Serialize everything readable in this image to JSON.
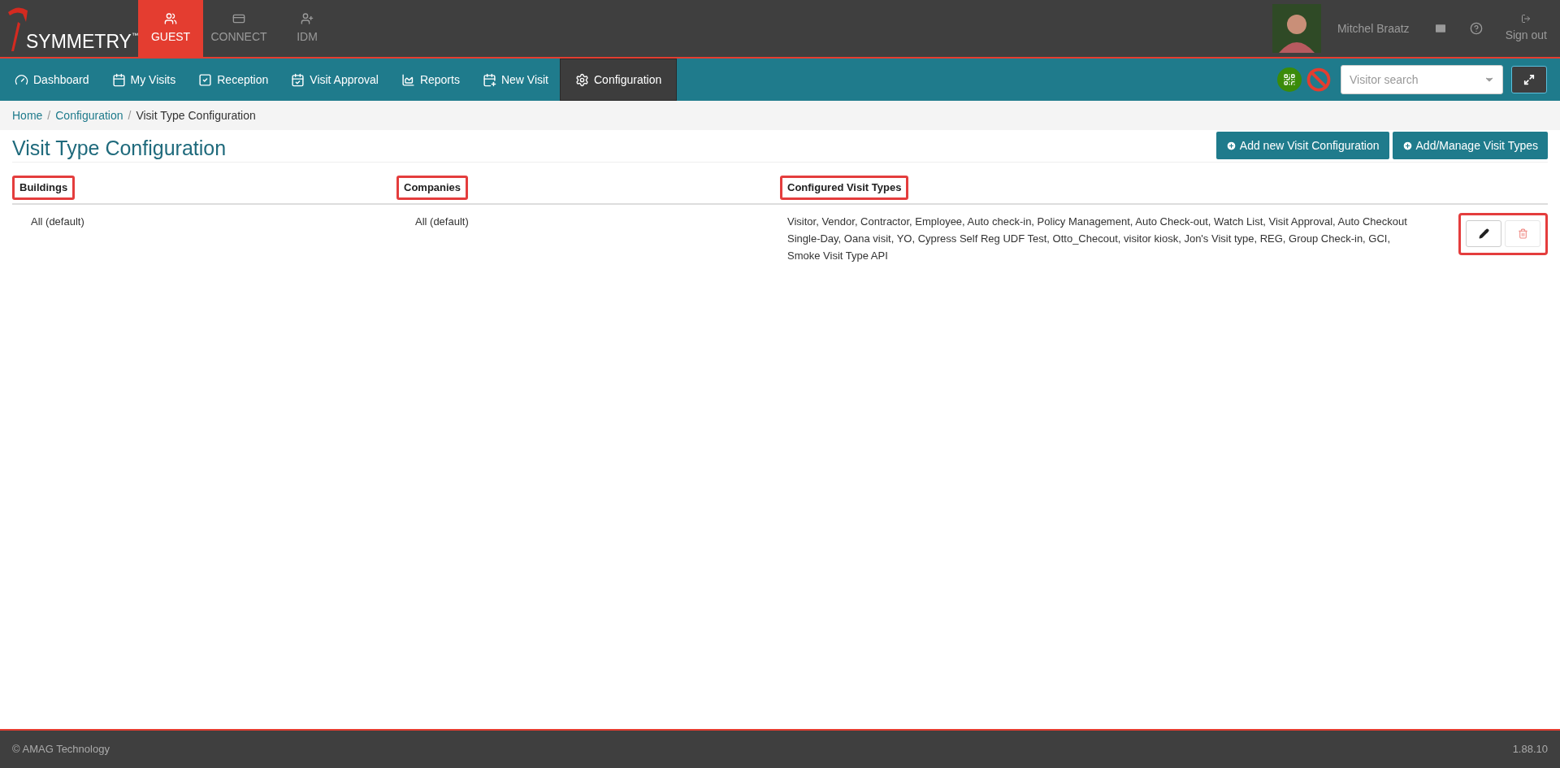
{
  "header": {
    "logo": "SYMMETRY",
    "logo_mark": "™",
    "apps": [
      {
        "label": "GUEST",
        "selected": true
      },
      {
        "label": "CONNECT",
        "selected": false
      },
      {
        "label": "IDM",
        "selected": false
      }
    ],
    "user_name": "Mitchel Braatz",
    "sign_out": "Sign out"
  },
  "nav": {
    "items": [
      {
        "label": "Dashboard",
        "selected": false
      },
      {
        "label": "My Visits",
        "selected": false
      },
      {
        "label": "Reception",
        "selected": false
      },
      {
        "label": "Visit Approval",
        "selected": false
      },
      {
        "label": "Reports",
        "selected": false
      },
      {
        "label": "New Visit",
        "selected": false
      },
      {
        "label": "Configuration",
        "selected": true
      }
    ],
    "search": {
      "placeholder": "Visitor search"
    }
  },
  "breadcrumb": [
    {
      "label": "Home",
      "link": true,
      "separator": "/"
    },
    {
      "label": "Configuration",
      "link": true,
      "separator": "/"
    },
    {
      "label": "Visit Type Configuration",
      "link": false
    }
  ],
  "page": {
    "title": "Visit Type Configuration",
    "buttons": [
      "Add new Visit Configuration",
      "Add/Manage Visit Types"
    ]
  },
  "table": {
    "columns": [
      {
        "label": "Buildings",
        "highlighted": true
      },
      {
        "label": "Companies",
        "highlighted": true
      },
      {
        "label": "Configured Visit Types",
        "highlighted": true
      }
    ],
    "rows": [
      {
        "cells": [
          "All (default)",
          "All (default)",
          "Visitor, Vendor, Contractor, Employee, Auto check-in, Policy Management, Auto Check-out, Watch List, Visit Approval, Auto Checkout Single-Day, Oana visit, YO, Cypress Self Reg UDF Test, Otto_Checout, visitor kiosk, Jon's Visit type, REG, Group Check-in, GCI, Smoke Visit Type API"
        ],
        "actions_highlighted": true
      }
    ]
  },
  "footer": {
    "copyright": "© AMAG Technology",
    "version": "1.88.10"
  }
}
